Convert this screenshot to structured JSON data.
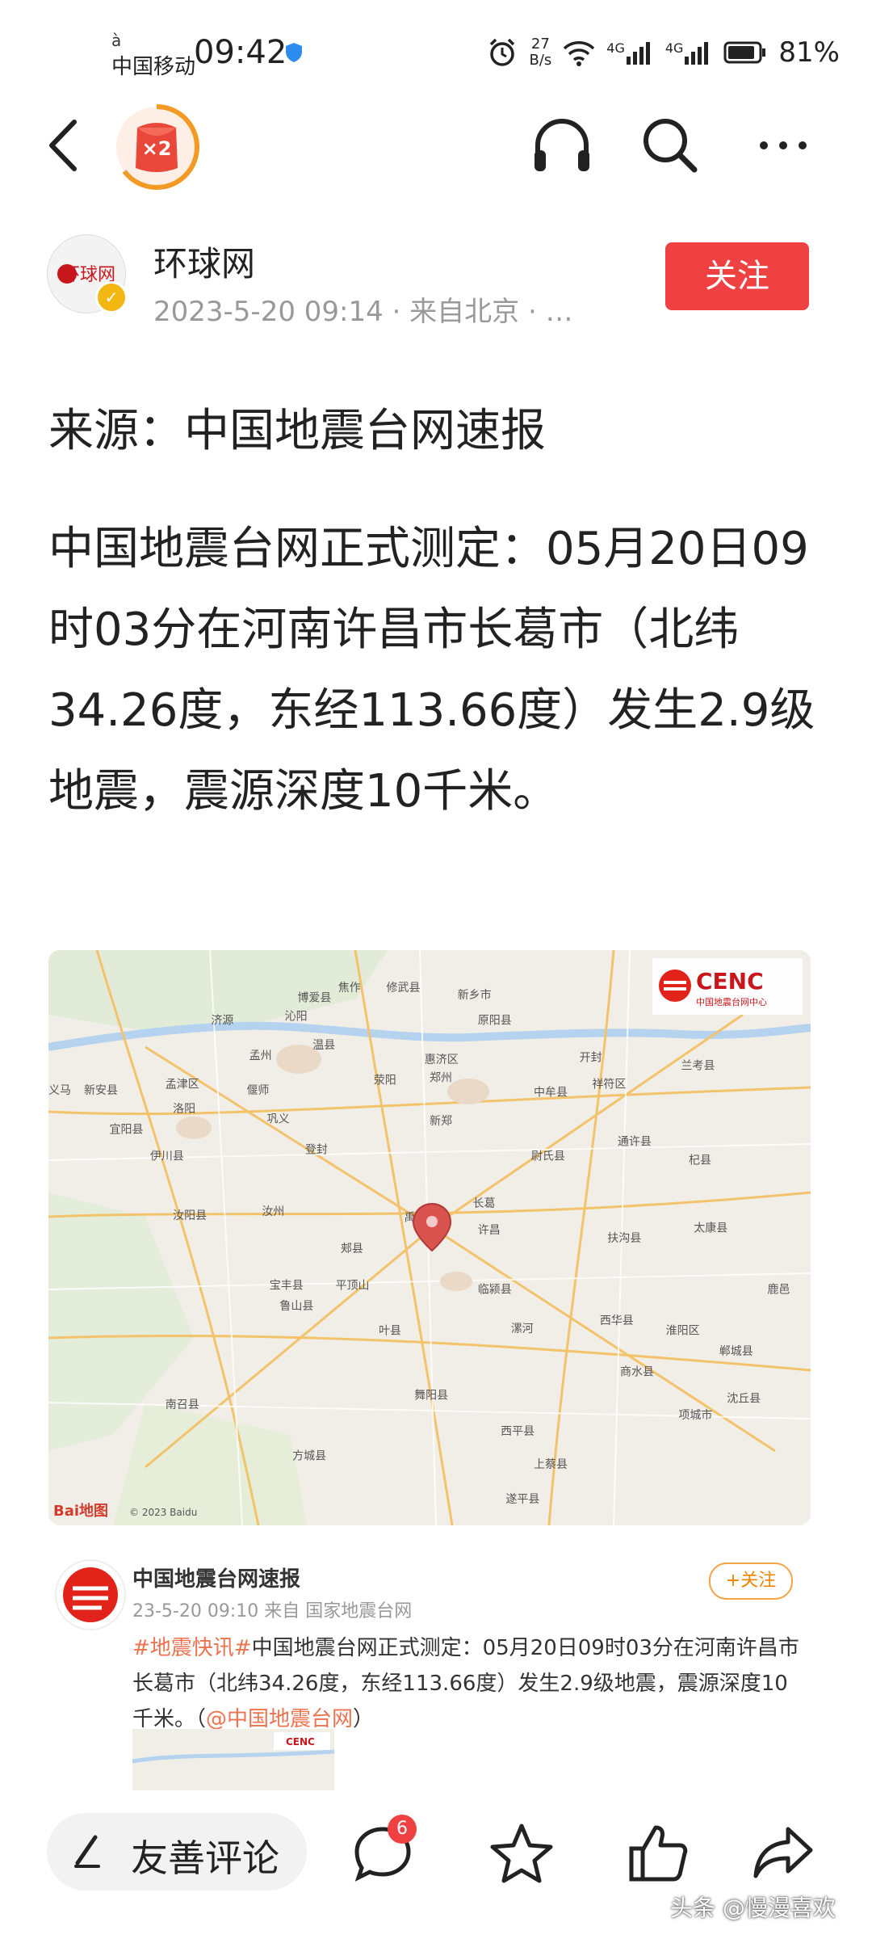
{
  "status_bar": {
    "carrier_top": "à",
    "carrier": "中国移动",
    "time": "09:42",
    "net_speed_value": "27",
    "net_speed_unit": "B/s",
    "signal1": "4G",
    "signal2": "4G",
    "battery": "81%"
  },
  "nav": {
    "badge_text": "×2"
  },
  "article": {
    "author": "环球网",
    "avatar_text": "环球网",
    "meta": "2023-5-20 09:14 · 来自北京 · …",
    "follow_label": "关注",
    "source_line": "来源：中国地震台网速报",
    "paragraph": "中国地震台网正式测定：05月20日09时03分在河南许昌市长葛市（北纬34.26度，东经113.66度）发生2.9级地震，震源深度10千米。"
  },
  "map": {
    "logo": "CENC",
    "logo_sub": "中国地震台网中心",
    "copyright": "© 2023 Baidu",
    "brand": "Bai地图",
    "places": [
      {
        "name": "焦作"
      },
      {
        "name": "修武县"
      },
      {
        "name": "新乡市"
      },
      {
        "name": "博爱县"
      },
      {
        "name": "济源"
      },
      {
        "name": "沁阳"
      },
      {
        "name": "原阳县"
      },
      {
        "name": "孟州"
      },
      {
        "name": "温县"
      },
      {
        "name": "郑州"
      },
      {
        "name": "惠济区"
      },
      {
        "name": "开封"
      },
      {
        "name": "兰考县"
      },
      {
        "name": "孟津区"
      },
      {
        "name": "偃师"
      },
      {
        "name": "荥阳"
      },
      {
        "name": "中牟县"
      },
      {
        "name": "祥符区"
      },
      {
        "name": "新安县"
      },
      {
        "name": "洛阳"
      },
      {
        "name": "巩义"
      },
      {
        "name": "登封"
      },
      {
        "name": "新郑"
      },
      {
        "name": "尉氏县"
      },
      {
        "name": "通许县"
      },
      {
        "name": "杞县"
      },
      {
        "name": "宜阳县"
      },
      {
        "name": "伊川县"
      },
      {
        "name": "长葛"
      },
      {
        "name": "禹州"
      },
      {
        "name": "汝州"
      },
      {
        "name": "汝阳县"
      },
      {
        "name": "许昌"
      },
      {
        "name": "扶沟县"
      },
      {
        "name": "太康县"
      },
      {
        "name": "郏县"
      },
      {
        "name": "宝丰县"
      },
      {
        "name": "平顶山"
      },
      {
        "name": "鲁山县"
      },
      {
        "name": "临颍县"
      },
      {
        "name": "西华县"
      },
      {
        "name": "淮阳区"
      },
      {
        "name": "叶县"
      },
      {
        "name": "漯河"
      },
      {
        "name": "商水县"
      },
      {
        "name": "郸城县"
      },
      {
        "name": "南召县"
      },
      {
        "name": "舞阳县"
      },
      {
        "name": "西平县"
      },
      {
        "name": "项城市"
      },
      {
        "name": "沈丘县"
      },
      {
        "name": "方城县"
      },
      {
        "name": "上蔡县"
      },
      {
        "name": "遂平县"
      },
      {
        "name": "鹿邑"
      },
      {
        "name": "义马"
      }
    ]
  },
  "weibo": {
    "name": "中国地震台网速报",
    "time_from": "23-5-20 09:10  来自 国家地震台网",
    "follow_label": "+关注",
    "tag": "#地震快讯#",
    "text": "中国地震台网正式测定：05月20日09时03分在河南许昌市长葛市（北纬34.26度，东经113.66度）发生2.9级地震，震源深度10千米。（",
    "mention": "@中国地震台网",
    "closing": "）",
    "thumb_logo": "CENC"
  },
  "bottom_bar": {
    "comment_placeholder": "友善评论",
    "comment_count": "6"
  },
  "watermark": "头条 @慢漫喜欢",
  "colors": {
    "accent_red": "#f04142",
    "meta_gray": "#999999",
    "weibo_orange": "#f08300"
  }
}
